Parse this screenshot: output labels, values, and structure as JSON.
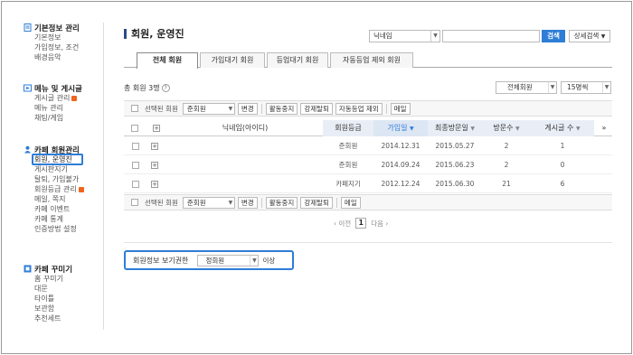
{
  "sidebar": {
    "sections": [
      {
        "title": "기본정보 관리",
        "icon": "document-icon",
        "items": [
          "기본정보",
          "가입정보, 조건",
          "배경음악"
        ]
      },
      {
        "title": "메뉴 및 게시글",
        "icon": "menu-icon",
        "items": [
          "게시글 관리",
          "메뉴 관리",
          "채팅/게임"
        ]
      },
      {
        "title": "카페 회원관리",
        "icon": "members-icon",
        "items": [
          "회원, 운영진",
          "게시판지기",
          "탈퇴, 가입불가",
          "회원등급 관리",
          "메일, 쪽지",
          "카페 이벤트",
          "카페 통계",
          "인증방법 설정"
        ]
      },
      {
        "title": "카페 꾸미기",
        "icon": "brush-icon",
        "items": [
          "홈 꾸미기",
          "대문",
          "타이틀",
          "보관함",
          "추천세트"
        ]
      }
    ]
  },
  "header": {
    "title": "회원, 운영진",
    "search_field": "닉네임",
    "search_value": "",
    "search_button": "검색",
    "advanced_search": "상세검색"
  },
  "tabs": [
    "전체 회원",
    "가입대기 회원",
    "등업대기 회원",
    "자동등업 제외 회원"
  ],
  "summary": {
    "total_label": "총 회원 3명",
    "filter": "전체회원",
    "per_page": "15명씩"
  },
  "toolbar": {
    "selected_label": "선택된 회원",
    "grade_select": "준회원",
    "change": "변경",
    "suspend": "활동중지",
    "force_withdraw": "강제탈퇴",
    "exclude_auto": "자동등업 제외",
    "mail": "메일"
  },
  "table": {
    "columns": [
      "닉네임(아이디)",
      "회원등급",
      "가입일",
      "최종방문일",
      "방문수",
      "게시글 수"
    ],
    "more": "»",
    "rows": [
      {
        "nickname": "",
        "grade": "준회원",
        "joined": "2014.12.31",
        "last_visit": "2015.05.27",
        "visits": "2",
        "posts": "1"
      },
      {
        "nickname": "",
        "grade": "준회원",
        "joined": "2014.09.24",
        "last_visit": "2015.06.23",
        "visits": "2",
        "posts": "0"
      },
      {
        "nickname": "",
        "grade": "카페지기",
        "joined": "2012.12.24",
        "last_visit": "2015.06.30",
        "visits": "21",
        "posts": "6"
      }
    ]
  },
  "pager": {
    "prev": "‹ 이전",
    "current": "1",
    "next": "다음 ›"
  },
  "permission": {
    "label": "회원정보 보기권한",
    "value": "정회원",
    "suffix": "이상"
  },
  "colors": {
    "accent": "#2e7dd7",
    "badge": "#f0641e"
  }
}
